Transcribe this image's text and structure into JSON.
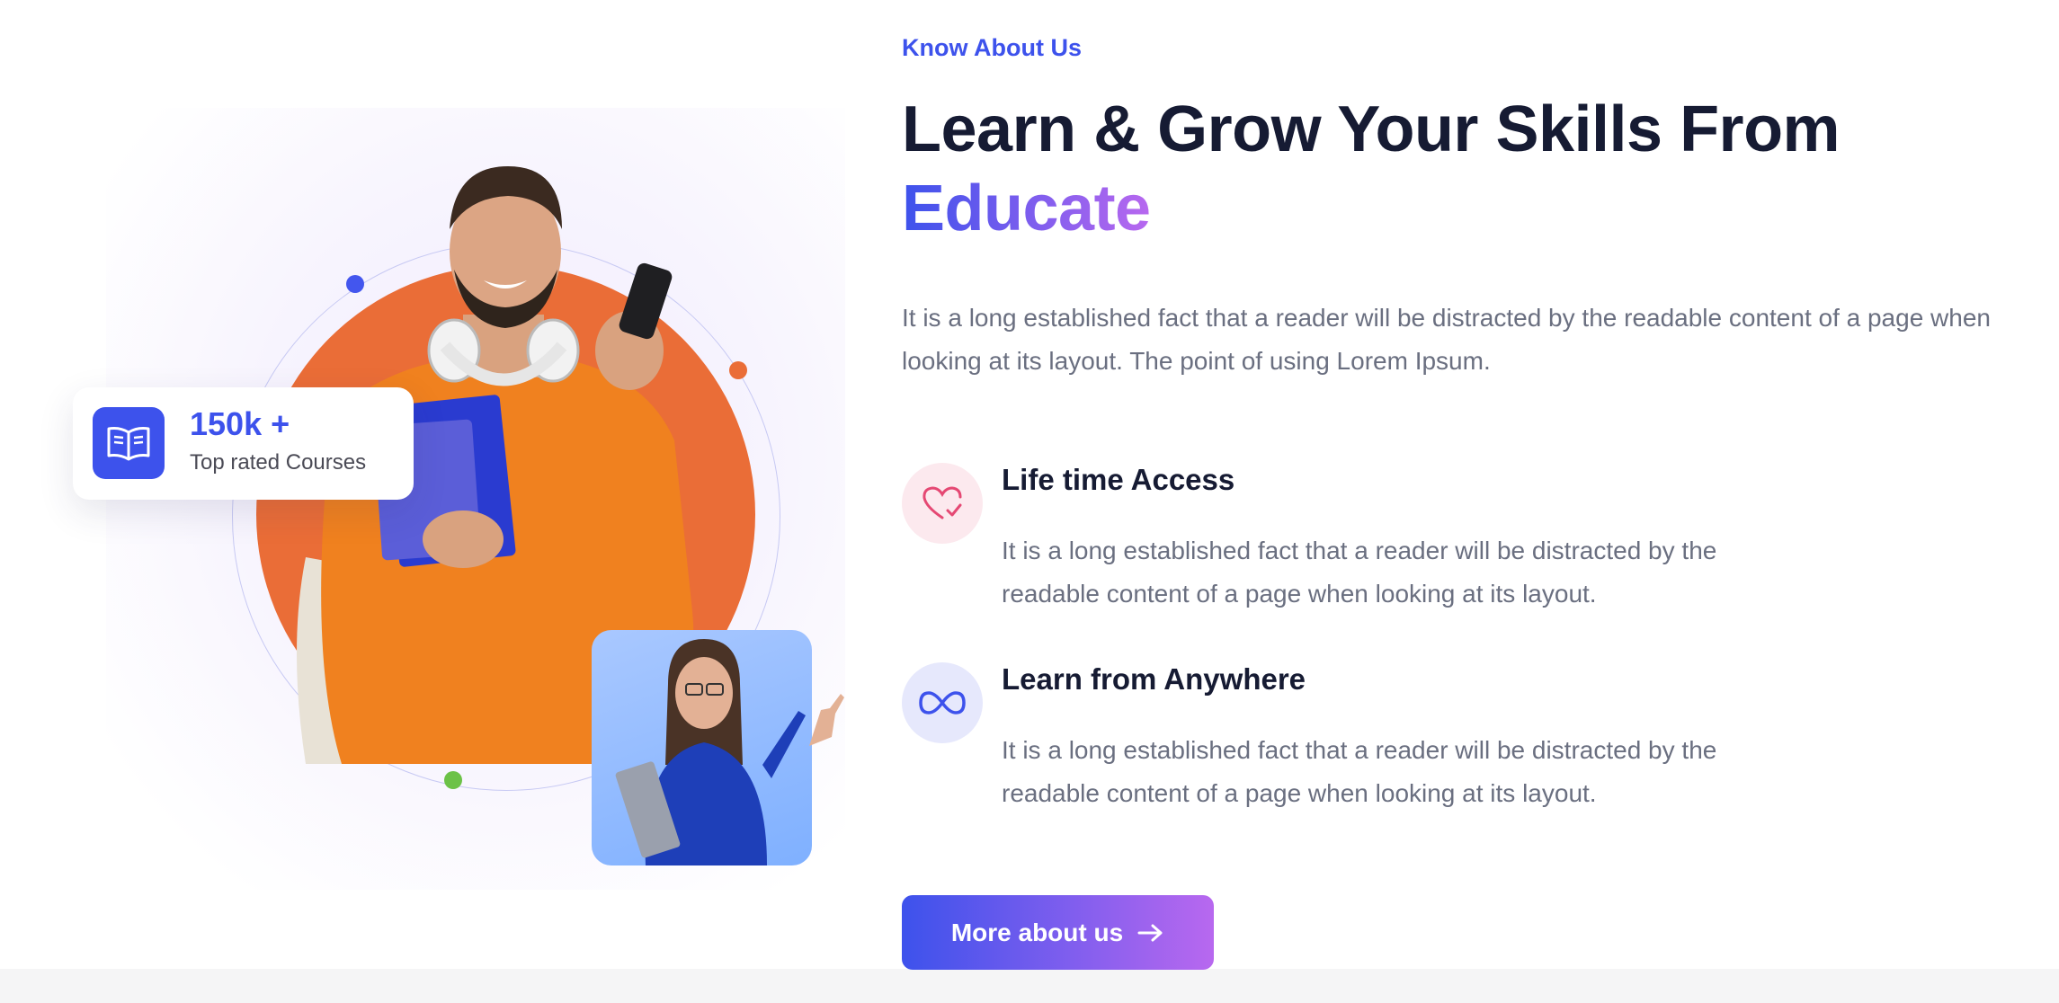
{
  "about": {
    "eyebrow": "Know About Us",
    "heading_main": "Learn & Grow Your Skills From",
    "heading_accent": "Educate",
    "intro": "It is a long established fact that a reader will be distracted by the readable content of a page when looking at its layout. The point of using Lorem Ipsum.",
    "stat": {
      "value": "150k +",
      "label": "Top rated Courses",
      "icon": "book-open-icon"
    },
    "features": [
      {
        "title": "Life time Access",
        "desc": "It is a long established fact that a reader will be distracted by the readable content of a page when looking at its layout.",
        "icon": "heart-check-icon"
      },
      {
        "title": "Learn from Anywhere",
        "desc": "It is a long established fact that a reader will be distracted by the readable content of a page when looking at its layout.",
        "icon": "infinity-icon"
      }
    ],
    "cta_label": "More about us",
    "cta_icon": "arrow-right-icon"
  },
  "colors": {
    "primary": "#3d52ec",
    "accent_gradient_end": "#b868ef",
    "orange": "#ea6d37",
    "green_dot": "#6cc247",
    "heading": "#161b33",
    "body_text": "#6a6f80"
  }
}
